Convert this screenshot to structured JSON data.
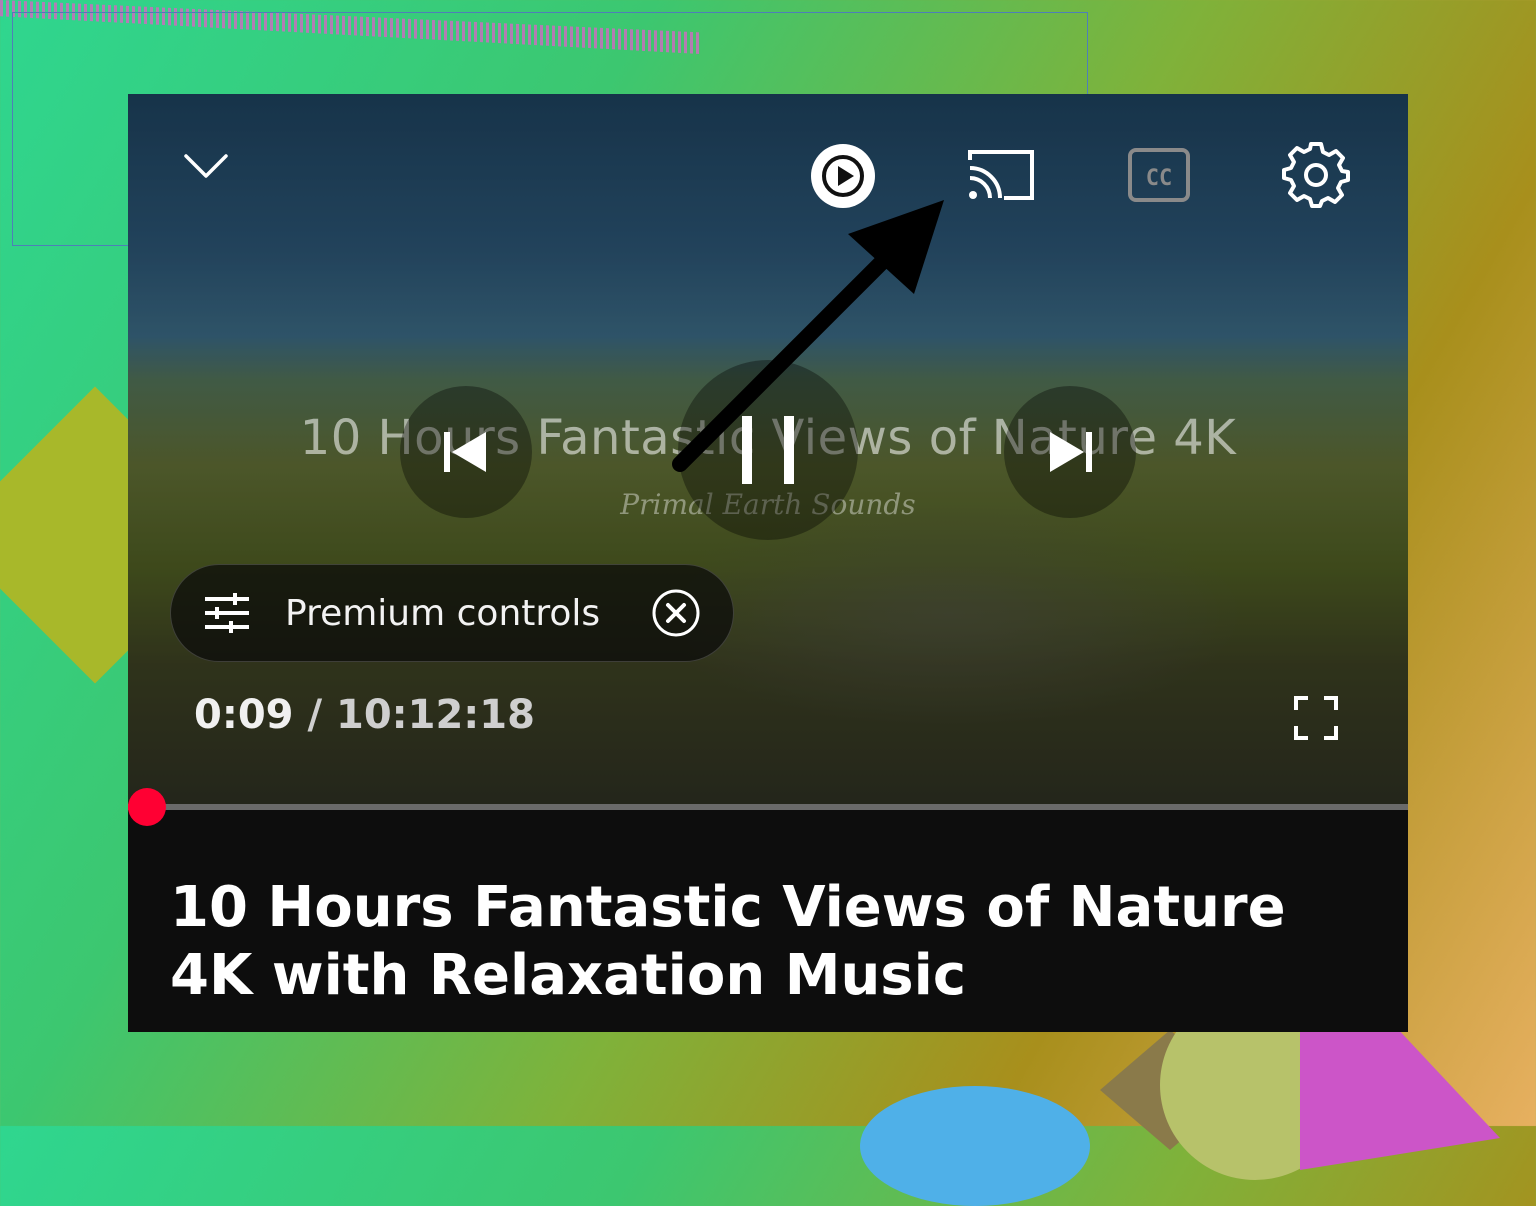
{
  "player": {
    "overlay_title": "10 Hours Fantastic Views of Nature 4K",
    "watermark": "Primal Earth Sounds",
    "premium_controls_label": "Premium controls",
    "current_time": "0:09",
    "separator": "/",
    "duration": "10:12:18",
    "progress_fraction": 0.0002,
    "accent_color": "#ff0033"
  },
  "top_bar": {
    "icons": [
      "chevron-down-icon",
      "autoplay-icon",
      "cast-icon",
      "captions-icon",
      "settings-icon"
    ],
    "captions_text": "CC"
  },
  "video_info": {
    "title": "10 Hours Fantastic Views of Nature 4K with Relaxation Music"
  }
}
